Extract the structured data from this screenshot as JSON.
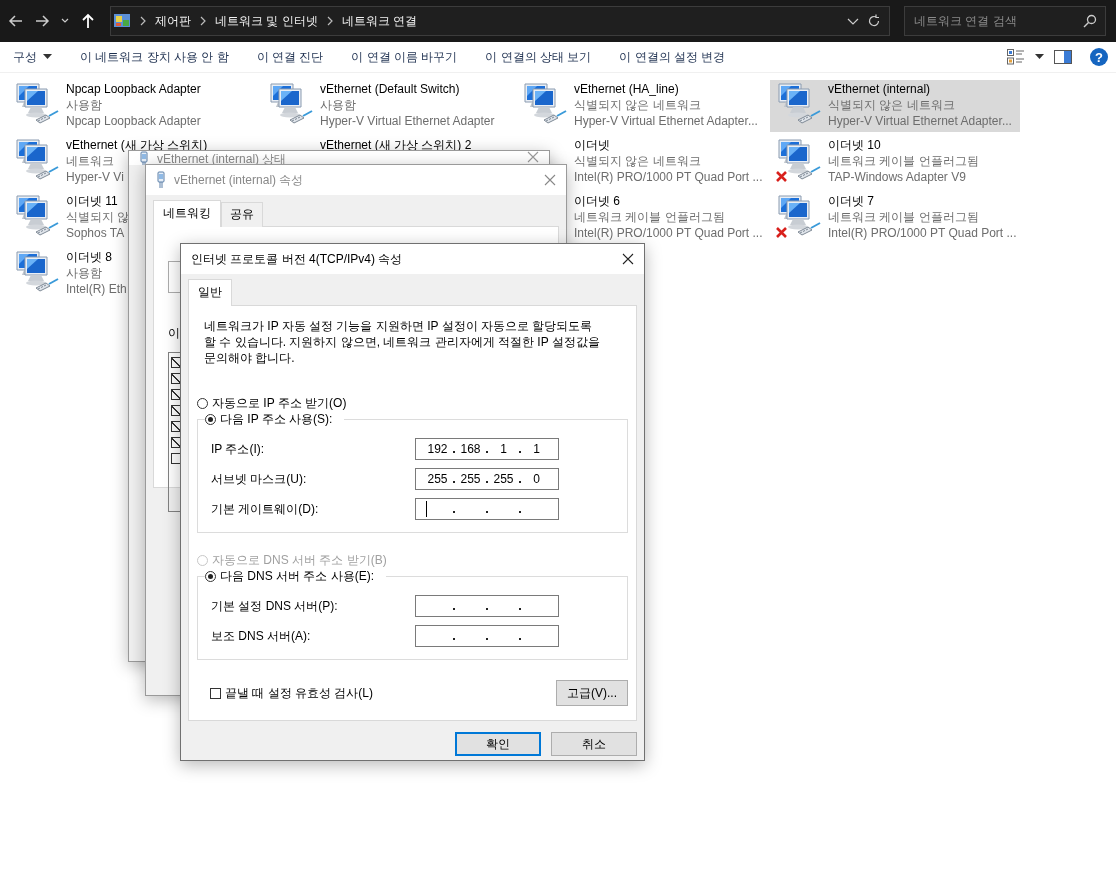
{
  "nav": {
    "breadcrumbs": [
      "제어판",
      "네트워크 및 인터넷",
      "네트워크 연결"
    ],
    "search_placeholder": "네트워크 연결 검색"
  },
  "commands": [
    {
      "label": "구성",
      "kind": "menu"
    },
    {
      "label": "이 네트워크 장치 사용 안 함",
      "kind": "action"
    },
    {
      "label": "이 연결 진단",
      "kind": "action"
    },
    {
      "label": "이 연결 이름 바꾸기",
      "kind": "action"
    },
    {
      "label": "이 연결의 상태 보기",
      "kind": "action"
    },
    {
      "label": "이 연결의 설정 변경",
      "kind": "action"
    }
  ],
  "help_glyph": "?",
  "adapter_columns": [
    [
      {
        "name": "Npcap Loopback Adapter",
        "status": "사용함",
        "device": "Npcap Loopback Adapter",
        "selected": false,
        "disconnected": false
      },
      {
        "name": "vEthernet (새 가상 스위치)",
        "status": "네트워크",
        "device": "Hyper-V Vi",
        "selected": false,
        "disconnected": false
      },
      {
        "name": "이더넷 11",
        "status": "식별되지 않",
        "device": "Sophos TA",
        "selected": false,
        "disconnected": false
      },
      {
        "name": "이더넷 8",
        "status": "사용함",
        "device": "Intel(R) Eth",
        "selected": false,
        "disconnected": false
      }
    ],
    [
      {
        "name": "vEthernet (Default Switch)",
        "status": "사용함",
        "device": "Hyper-V Virtual Ethernet Adapter",
        "selected": false,
        "disconnected": false
      },
      {
        "name": "vEthernet (새 가상 스위치) 2",
        "selected": false
      }
    ],
    [
      {
        "name": "vEthernet (HA_line)",
        "status": "식별되지 않은 네트워크",
        "device": "Hyper-V Virtual Ethernet Adapter...",
        "selected": false,
        "disconnected": false
      },
      {
        "name": "이더넷",
        "status": "식별되지 않은 네트워크",
        "device": "Intel(R) PRO/1000 PT Quad Port ...",
        "selected": false
      },
      {
        "name": "이더넷 6",
        "status": "네트워크 케이블 언플러그됨",
        "device": "Intel(R) PRO/1000 PT Quad Port ...",
        "selected": false
      }
    ],
    [
      {
        "name": "vEthernet (internal)",
        "status": "식별되지 않은 네트워크",
        "device": "Hyper-V Virtual Ethernet Adapter...",
        "selected": true,
        "disconnected": false
      },
      {
        "name": "이더넷 10",
        "status": "네트워크 케이블 언플러그됨",
        "device": "TAP-Windows Adapter V9",
        "selected": false,
        "disconnected": true
      },
      {
        "name": "이더넷 7",
        "status": "네트워크 케이블 언플러그됨",
        "device": "Intel(R) PRO/1000 PT Quad Port ...",
        "selected": false,
        "disconnected": true
      }
    ]
  ],
  "status_window": {
    "title": "vEthernet (internal) 상태"
  },
  "properties_window": {
    "title": "vEthernet (internal) 속성",
    "tabs": [
      {
        "label": "네트워킹",
        "selected": true
      },
      {
        "label": "공유",
        "selected": false
      }
    ],
    "items_label": "이",
    "items": [
      {
        "checked": true
      },
      {
        "checked": true
      },
      {
        "checked": true
      },
      {
        "checked": true
      },
      {
        "checked": true
      },
      {
        "checked": true
      },
      {
        "checked": false
      }
    ]
  },
  "ipv4_dialog": {
    "title": "인터넷 프로토콜 버전 4(TCP/IPv4) 속성",
    "tabs": [
      {
        "label": "일반",
        "selected": true
      }
    ],
    "description": "네트워크가 IP 자동 설정 기능을 지원하면 IP 설정이 자동으로 할당되도록 할 수 있습니다. 지원하지 않으면, 네트워크 관리자에게 적절한 IP 설정값을 문의해야 합니다.",
    "ip_mode": [
      {
        "label": "자동으로 IP 주소 받기(O)",
        "selected": false,
        "disabled": false
      },
      {
        "label": "다음 IP 주소 사용(S):",
        "selected": true,
        "disabled": false
      }
    ],
    "ip_fields": [
      {
        "label": "IP 주소(I):",
        "octets": [
          "192",
          "168",
          "1",
          "1"
        ],
        "focused": false
      },
      {
        "label": "서브넷 마스크(U):",
        "octets": [
          "255",
          "255",
          "255",
          "0"
        ],
        "focused": false
      },
      {
        "label": "기본 게이트웨이(D):",
        "focused": true
      }
    ],
    "dns_mode": [
      {
        "label": "자동으로 DNS 서버 주소 받기(B)",
        "selected": false,
        "disabled": true
      },
      {
        "label": "다음 DNS 서버 주소 사용(E):",
        "selected": true,
        "disabled": false
      }
    ],
    "dns_fields": [
      {
        "label": "기본 설정 DNS 서버(P):",
        "focused": false
      },
      {
        "label": "보조 DNS 서버(A):",
        "focused": false
      }
    ],
    "validate": {
      "label": "끝낼 때 설정 유효성 검사(L)",
      "checked": false
    },
    "advanced_button": "고급(V)...",
    "buttons": [
      {
        "label": "확인",
        "default": true
      },
      {
        "label": "취소",
        "default": false
      }
    ]
  }
}
